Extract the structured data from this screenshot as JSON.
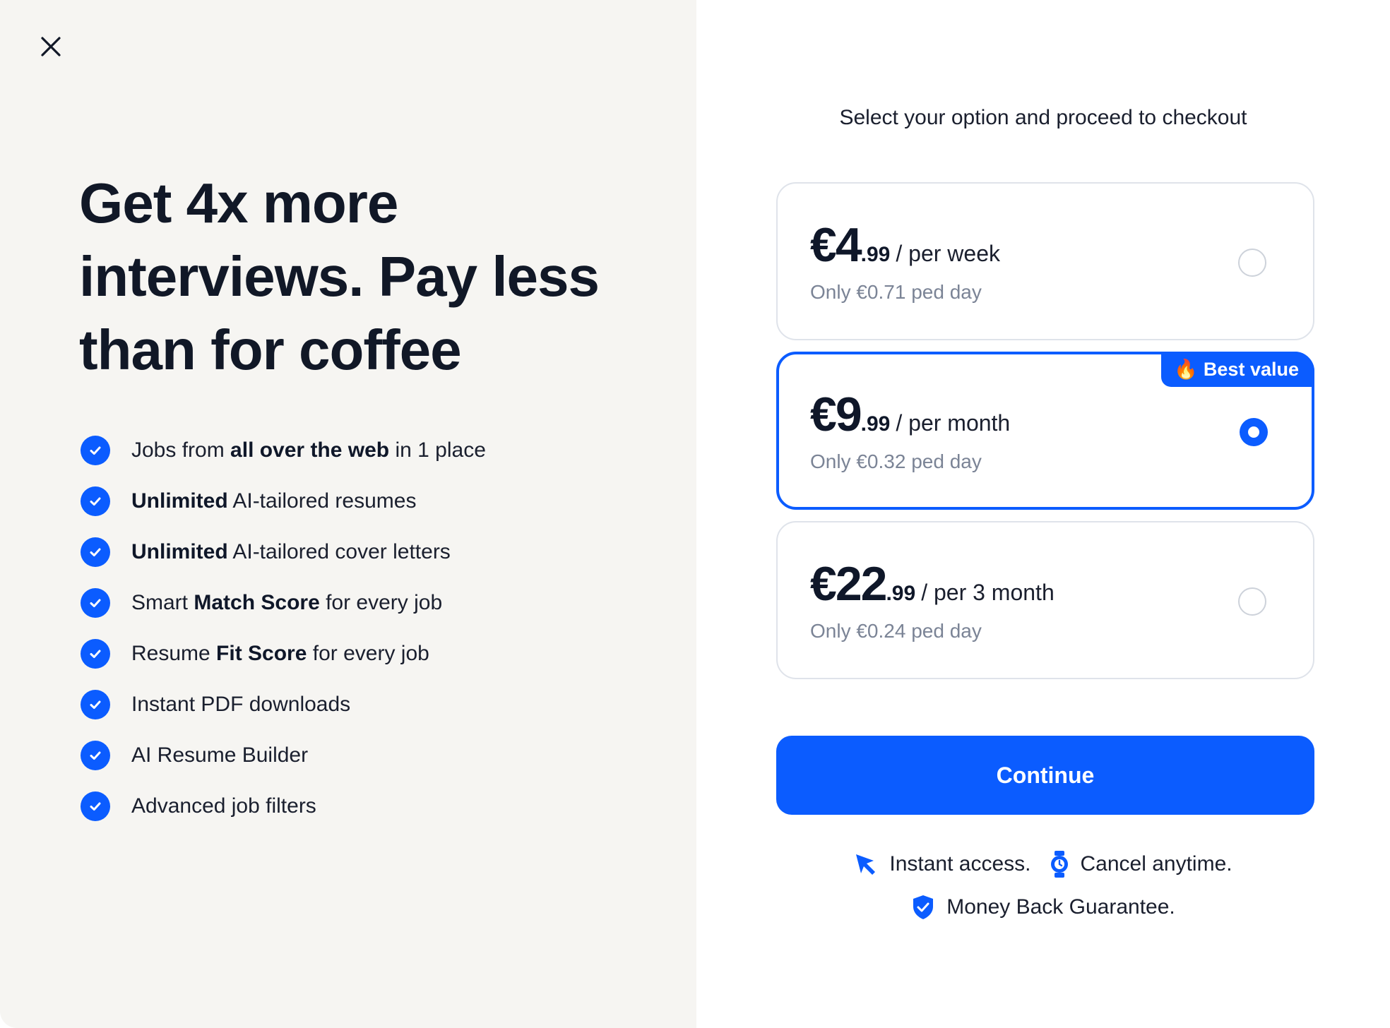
{
  "left": {
    "headline": "Get 4x more interviews. Pay less than for coffee",
    "features": [
      {
        "pre": "Jobs from ",
        "bold": "all over the web",
        "post": " in 1 place"
      },
      {
        "pre": "",
        "bold": "Unlimited",
        "post": " AI-tailored resumes"
      },
      {
        "pre": "",
        "bold": "Unlimited",
        "post": " AI-tailored cover letters"
      },
      {
        "pre": "Smart ",
        "bold": "Match Score",
        "post": " for every job"
      },
      {
        "pre": "Resume ",
        "bold": "Fit Score",
        "post": " for every job"
      },
      {
        "pre": "Instant PDF downloads",
        "bold": "",
        "post": ""
      },
      {
        "pre": "AI Resume Builder",
        "bold": "",
        "post": ""
      },
      {
        "pre": "Advanced job filters",
        "bold": "",
        "post": ""
      }
    ]
  },
  "right": {
    "subtitle": "Select your option and proceed to checkout",
    "plans": [
      {
        "main": "€4",
        "cents": ".99",
        "period": "/ per week",
        "daily": "Only €0.71 ped day",
        "selected": false
      },
      {
        "main": "€9",
        "cents": ".99",
        "period": "/ per month",
        "daily": "Only €0.32 ped day",
        "selected": true,
        "badge": "Best value",
        "badge_icon": "🔥"
      },
      {
        "main": "€22",
        "cents": ".99",
        "period": "/ per 3 month",
        "daily": "Only €0.24 ped day",
        "selected": false
      }
    ],
    "continue_label": "Continue",
    "assurances": {
      "instant": "Instant access.",
      "cancel": "Cancel anytime.",
      "guarantee": "Money Back Guarantee."
    }
  },
  "colors": {
    "accent": "#0b5cff",
    "left_bg": "#f6f5f2",
    "muted_text": "#7b8496"
  }
}
